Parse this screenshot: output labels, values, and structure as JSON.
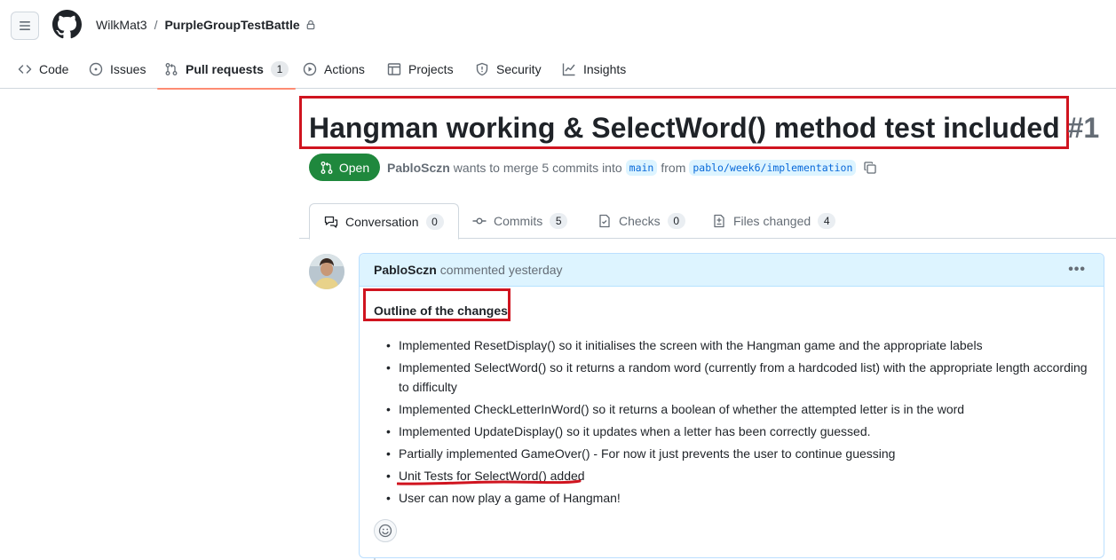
{
  "header": {
    "owner": "WilkMat3",
    "separator": "/",
    "repo": "PurpleGroupTestBattle"
  },
  "repo_nav": [
    {
      "label": "Code",
      "icon": "code-icon"
    },
    {
      "label": "Issues",
      "icon": "issue-icon"
    },
    {
      "label": "Pull requests",
      "icon": "pull-request-icon",
      "count": "1",
      "active": true
    },
    {
      "label": "Actions",
      "icon": "play-icon"
    },
    {
      "label": "Projects",
      "icon": "table-icon"
    },
    {
      "label": "Security",
      "icon": "shield-icon"
    },
    {
      "label": "Insights",
      "icon": "graph-icon"
    }
  ],
  "pr": {
    "title": "Hangman working & SelectWord() method test included",
    "number": "#1",
    "state": "Open",
    "author": "PabloSczn",
    "merge_text": "wants to merge 5 commits into",
    "base_branch": "main",
    "from_text": "from",
    "head_branch": "pablo/week6/implementation"
  },
  "pr_tabs": [
    {
      "label": "Conversation",
      "count": "0",
      "icon": "comment-discussion-icon"
    },
    {
      "label": "Commits",
      "count": "5",
      "icon": "commit-icon"
    },
    {
      "label": "Checks",
      "count": "0",
      "icon": "checklist-icon"
    },
    {
      "label": "Files changed",
      "count": "4",
      "icon": "file-diff-icon"
    }
  ],
  "comment": {
    "author": "PabloSczn",
    "meta": "commented yesterday",
    "heading": "Outline of the changes",
    "items": [
      "Implemented ResetDisplay() so it initialises the screen with the Hangman game and the appropriate labels",
      "Implemented SelectWord() so it returns a random word (currently from a hardcoded list) with the appropriate length according to difficulty",
      "Implemented CheckLetterInWord() so it returns a boolean of whether the attempted letter is in the word",
      "Implemented UpdateDisplay() so it updates when a letter has been correctly guessed.",
      "Partially implemented GameOver() - For now it just prevents the user to continue guessing",
      "Unit Tests for SelectWord() added",
      "User can now play a game of Hangman!"
    ]
  },
  "colors": {
    "annotation_red": "#d0141f",
    "open_green": "#1f883d",
    "active_tab_underline": "#fd8c73",
    "comment_header_bg": "#ddf4ff"
  }
}
